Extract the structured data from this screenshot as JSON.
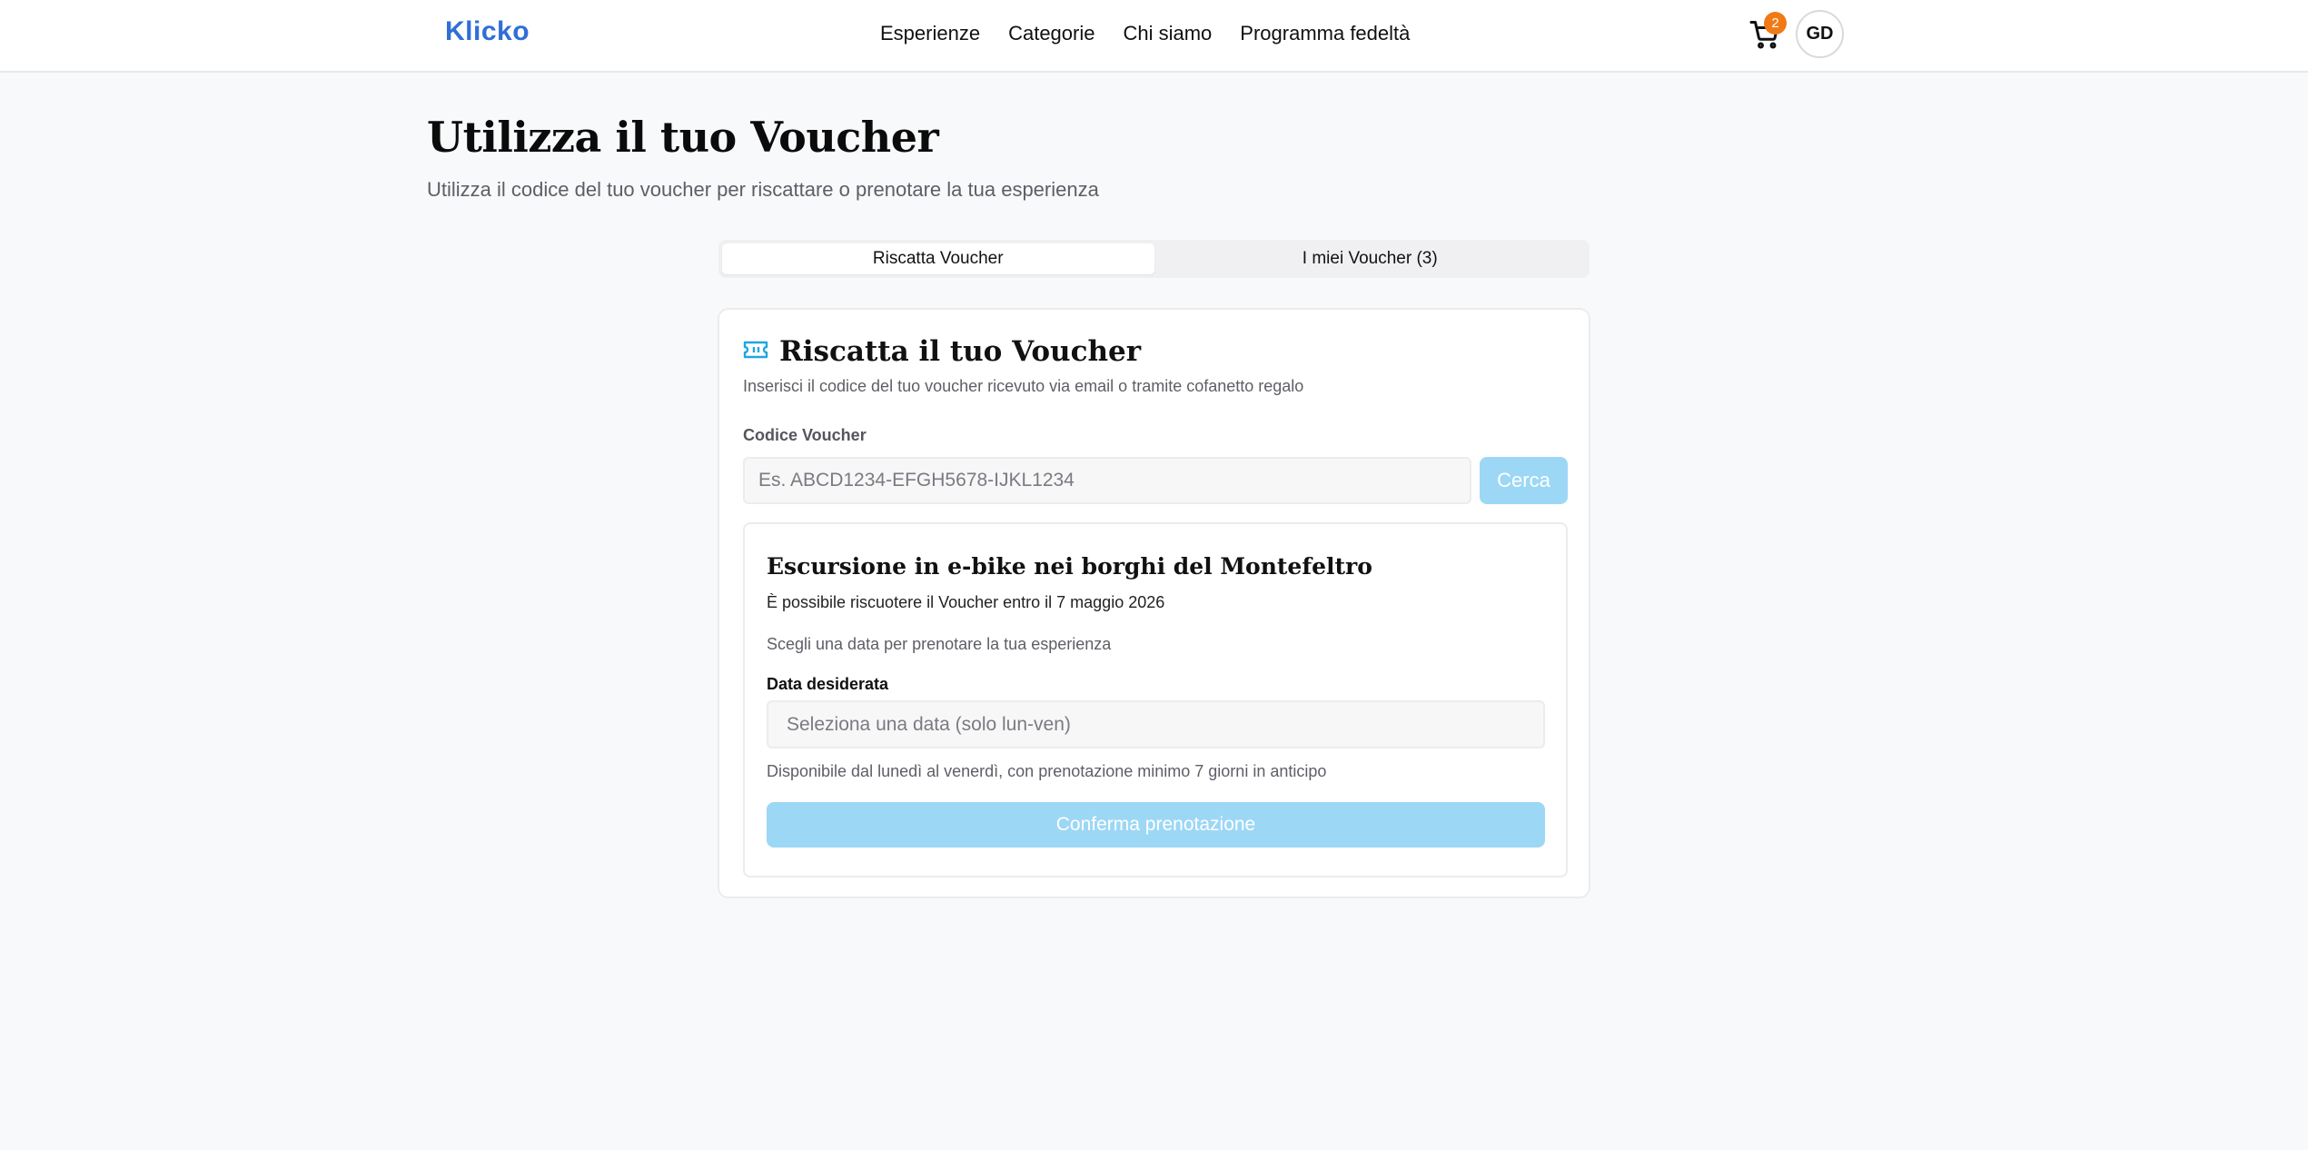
{
  "nav": {
    "logo": "Klicko",
    "links": [
      "Esperienze",
      "Categorie",
      "Chi siamo",
      "Programma fedeltà"
    ],
    "cart_count": "2",
    "avatar_initials": "GD"
  },
  "page": {
    "title": "Utilizza il tuo Voucher",
    "subtitle": "Utilizza il codice del tuo voucher per riscattare o prenotare la tua esperienza"
  },
  "tabs": [
    {
      "label": "Riscatta Voucher",
      "active": true
    },
    {
      "label": "I miei Voucher (3)",
      "active": false
    }
  ],
  "redeem_card": {
    "title": "Riscatta il tuo Voucher",
    "description": "Inserisci il codice del tuo voucher ricevuto via email o tramite cofanetto regalo",
    "code_label": "Codice Voucher",
    "code_placeholder": "Es. ABCD1234-EFGH5678-IJKL1234",
    "search_label": "Cerca"
  },
  "experience": {
    "title": "Escursione in e-bike nei borghi del Montefeltro",
    "deadline": "È possibile riscuotere il Voucher entro il 7 maggio 2026",
    "choose_text": "Scegli una data per prenotare la tua esperienza",
    "date_label": "Data desiderata",
    "date_placeholder": "Seleziona una data (solo lun-ven)",
    "date_hint": "Disponibile dal lunedì al venerdì, con prenotazione minimo 7 giorni in anticipo",
    "confirm_label": "Conferma prenotazione"
  },
  "colors": {
    "brand": "#2f6fd6",
    "button_disabled": "#9dd7f6",
    "badge": "#f07a16",
    "ticket_icon": "#1ea7e1"
  },
  "icons": [
    "cart-icon",
    "ticket-icon"
  ]
}
